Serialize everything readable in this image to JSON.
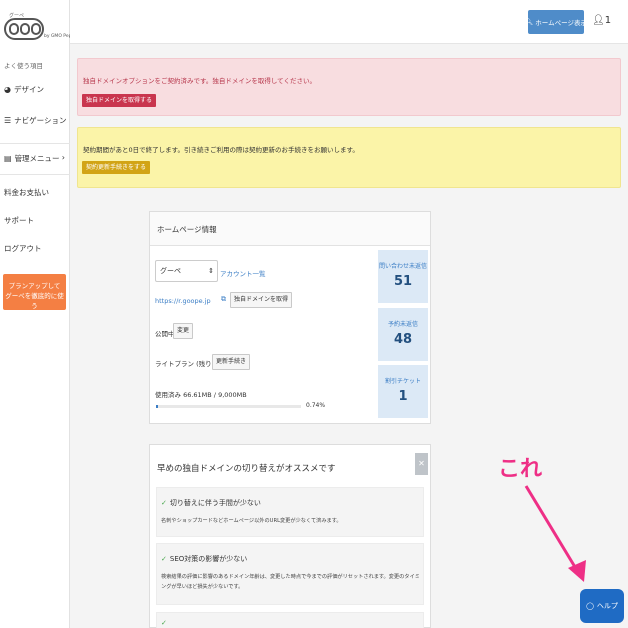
{
  "logo": {
    "small": "グーペ",
    "gmo": "by GMO Pepabo"
  },
  "sidebar": {
    "heading": "よく使う項目",
    "items": [
      {
        "label": "デザイン",
        "icon": "palette-icon"
      },
      {
        "label": "ナビゲーション",
        "icon": "list-icon"
      },
      {
        "label": "管理メニュー",
        "icon": "menu-icon"
      },
      {
        "label": "料金お支払い"
      },
      {
        "label": "サポート"
      },
      {
        "label": "ログアウト"
      }
    ],
    "plan_button": {
      "line1": "プランアップして",
      "line2": "グーペを徹底的に使う"
    }
  },
  "topbar": {
    "homepage_button": "ホームページ表示",
    "user": "1"
  },
  "alerts": {
    "red": {
      "message": "独自ドメインオプションをご契約済みです。独自ドメインを取得してください。",
      "button": "独自ドメインを取得する"
    },
    "yellow": {
      "message": "契約期間があと0日で終了します。引き続きご利用の際は契約更新のお手続きをお願いします。",
      "button": "契約更新手続きをする"
    }
  },
  "hp_info": {
    "title": "ホームページ情報",
    "select_value": "グーペ",
    "account_link": "アカウント一覧",
    "url": "https://r.goope.jp",
    "get_domain_button": "独自ドメインを取得",
    "status_label": "公開中",
    "change_button": "変更",
    "plan_label": "ライトプラン (残り0日)",
    "renew_button": "更新手続き",
    "usage_label": "使用済み 66.61MB / 9,000MB",
    "usage_percent_text": "0.74%",
    "usage_fraction": 0.0074,
    "stats": [
      {
        "label": "問い合わせ未返信",
        "value": "51"
      },
      {
        "label": "予約未返信",
        "value": "48"
      },
      {
        "label": "割引チケット",
        "value": "1"
      }
    ]
  },
  "recommend": {
    "title": "早めの独自ドメインの切り替えがオススメです",
    "items": [
      {
        "heading": "切り替えに伴う手間が少ない",
        "desc": "名刺やショップカードなどホームページ以外のURL変更が少なくて済みます。"
      },
      {
        "heading": "SEO対策の影響が少ない",
        "desc": "検索結果の評価に影響のあるドメイン年齢は、変更した時点で今までの評価がリセットされます。変更のタイミングが早いほど損失が少ないです。"
      },
      {
        "heading": "",
        "desc": ""
      }
    ]
  },
  "annotation": {
    "text": "これ"
  },
  "help_button": "ヘルプ"
}
